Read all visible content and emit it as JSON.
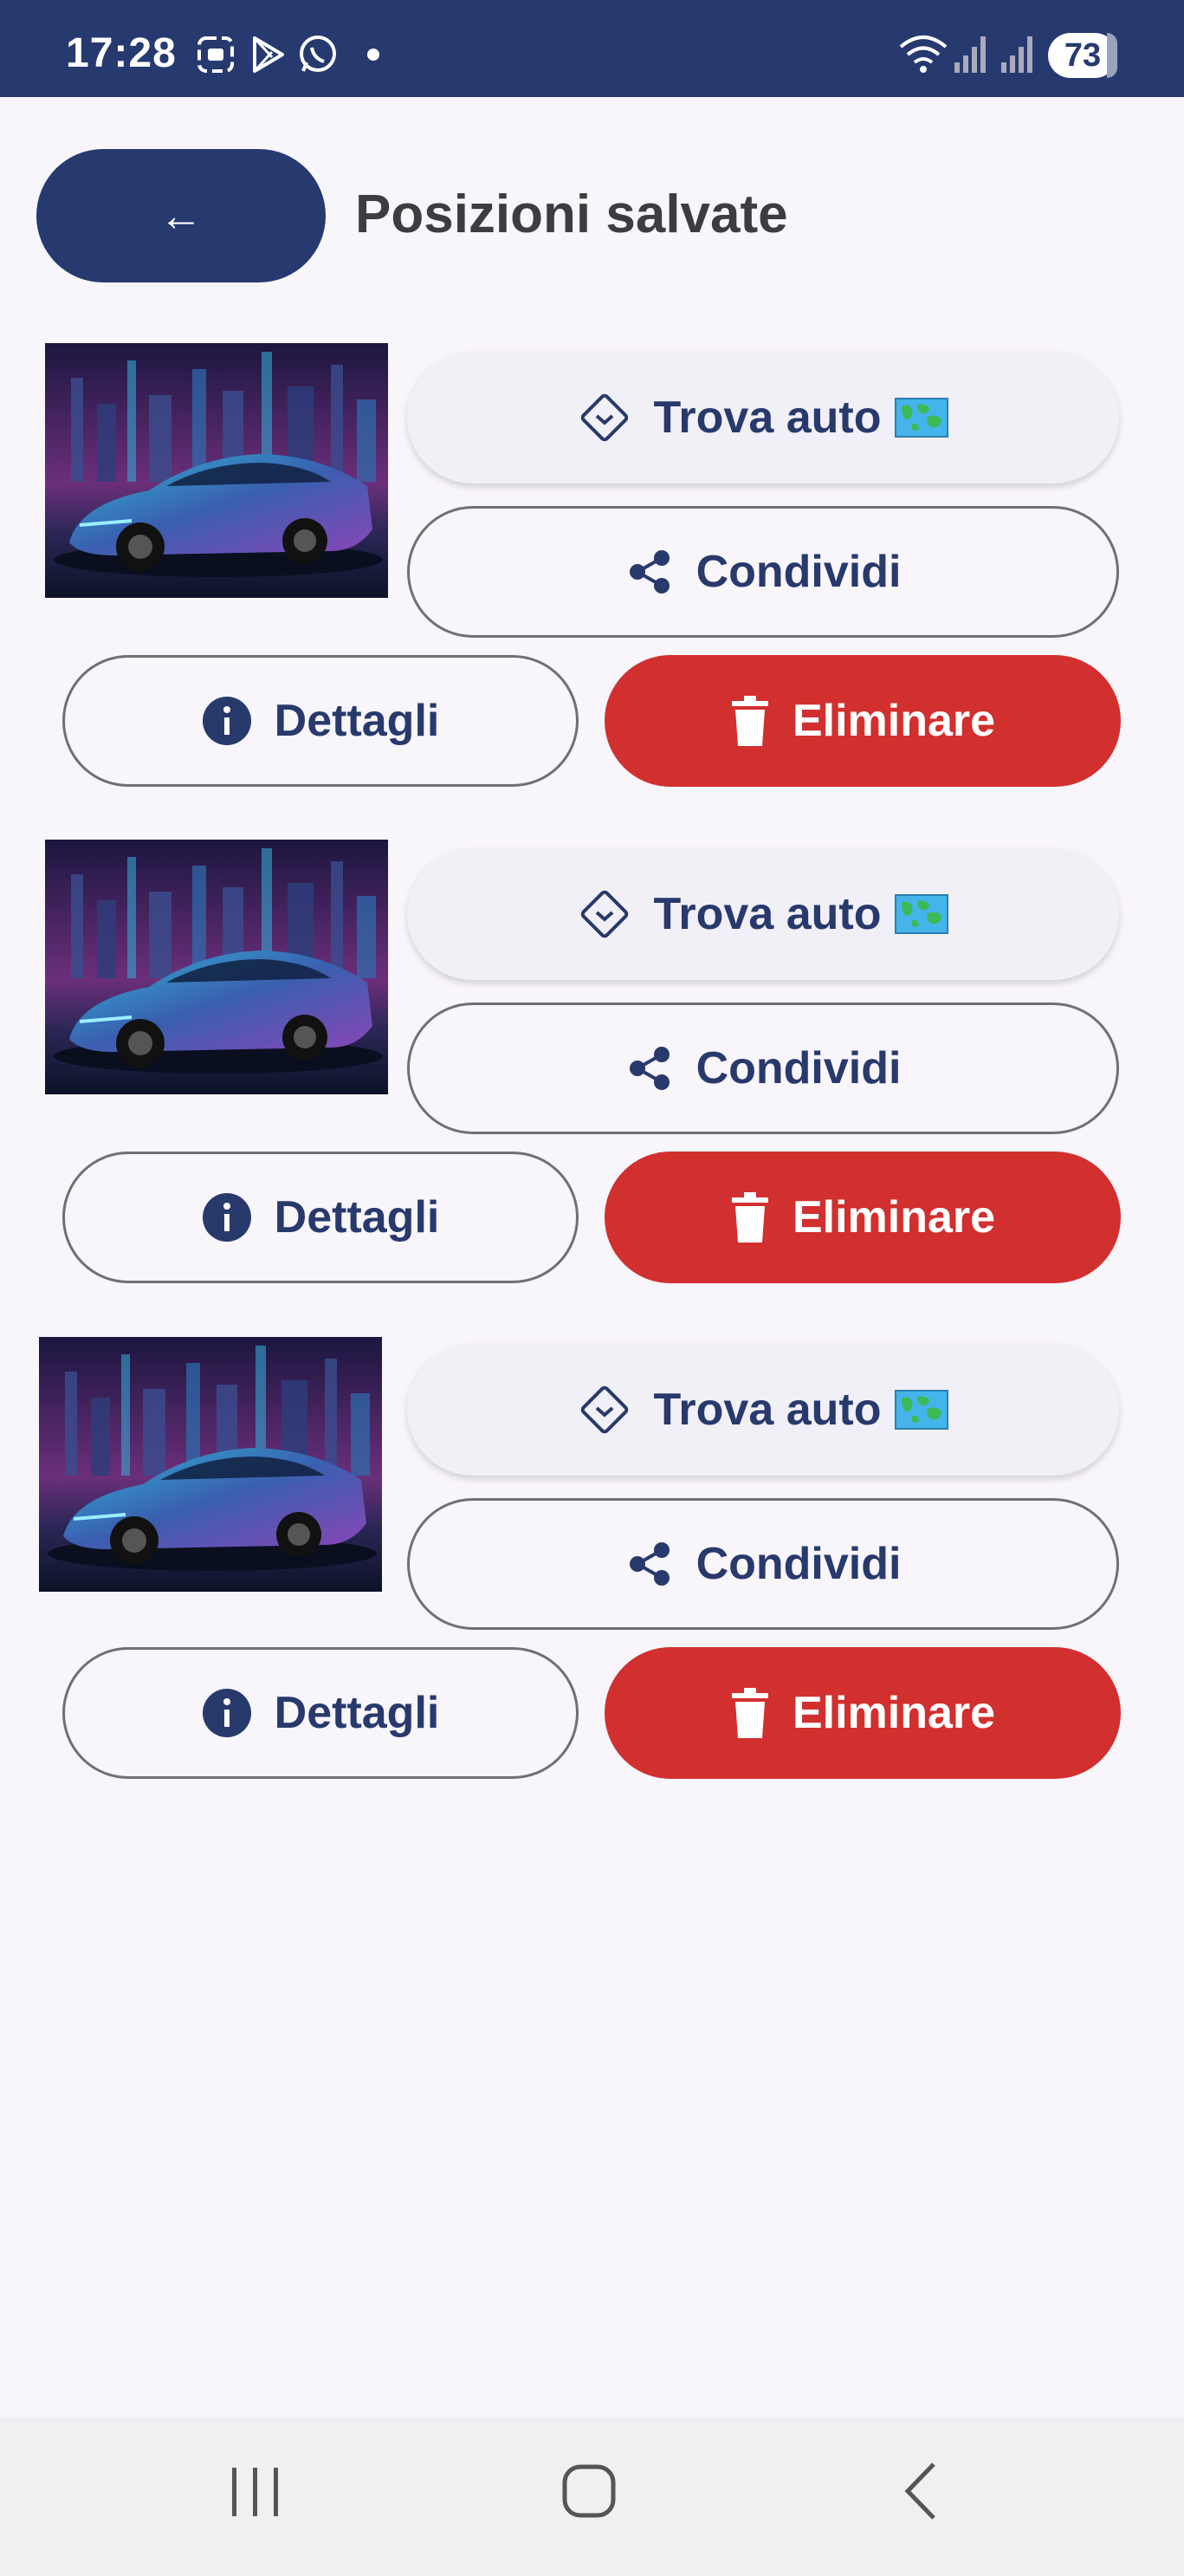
{
  "status_bar": {
    "time": "17:28",
    "battery": "73",
    "icons": [
      "screenshot-icon",
      "play-store-icon",
      "whatsapp-icon",
      "notification-dot-icon",
      "wifi-icon",
      "signal-icon",
      "signal-icon",
      "battery-icon"
    ]
  },
  "header": {
    "back_label": "←",
    "title": "Posizioni salvate"
  },
  "cards": [
    {
      "find_label": "Trova auto",
      "share_label": "Condividi",
      "details_label": "Dettagli",
      "delete_label": "Eliminare"
    },
    {
      "find_label": "Trova auto",
      "share_label": "Condividi",
      "details_label": "Dettagli",
      "delete_label": "Eliminare"
    },
    {
      "find_label": "Trova auto",
      "share_label": "Condividi",
      "details_label": "Dettagli",
      "delete_label": "Eliminare"
    }
  ],
  "nav_bar": {
    "items": [
      "recents-icon",
      "home-icon",
      "back-icon"
    ]
  },
  "colors": {
    "primary": "#263a70",
    "danger": "#d22f2f",
    "background": "#f8f5fb"
  }
}
